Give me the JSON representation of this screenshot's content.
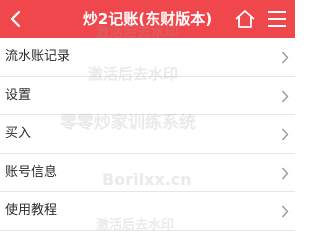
{
  "colors": {
    "brand": "#f0474c",
    "divider": "#e7e7e7",
    "chevron": "#9a9a9a"
  },
  "header": {
    "title": "炒2记账(东财版本)",
    "icons": {
      "back": "back-chevron-icon",
      "home": "home-icon",
      "menu": "hamburger-menu-icon"
    }
  },
  "menu": {
    "items": [
      {
        "label": "流水账记录"
      },
      {
        "label": "设置"
      },
      {
        "label": "买入"
      },
      {
        "label": "账号信息"
      },
      {
        "label": "使用教程"
      }
    ],
    "row_icon": "chevron-right-icon"
  },
  "watermarks": [
    "激活后去水印",
    "激活后去水印",
    "零零炒家训练系统",
    "Borilxx.cn",
    "激活后去水印"
  ]
}
